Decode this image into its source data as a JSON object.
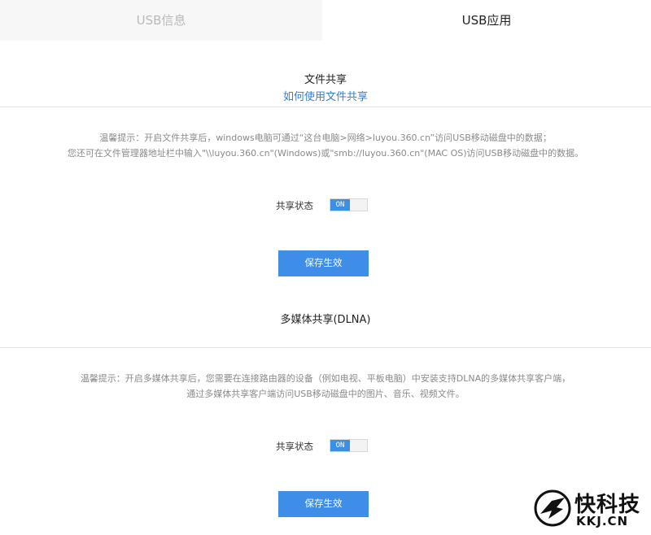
{
  "tabs": [
    {
      "label": "USB信息",
      "active": false
    },
    {
      "label": "USB应用",
      "active": true
    }
  ],
  "file_share": {
    "title": "文件共享",
    "help_link": "如何使用文件共享",
    "tip_line1": "温馨提示：开启文件共享后，windows电脑可通过“这台电脑>网络>luyou.360.cn”访问USB移动磁盘中的数据；",
    "tip_line2": "您还可在文件管理器地址栏中输入\"\\\\luyou.360.cn\"(Windows)或\"smb://luyou.360.cn\"(MAC OS)访问USB移动磁盘中的数据。",
    "status_label": "共享状态",
    "toggle_state": "ON",
    "save_label": "保存生效"
  },
  "dlna": {
    "title": "多媒体共享(DLNA)",
    "tip_line1": "温馨提示：开启多媒体共享后，您需要在连接路由器的设备（例如电视、平板电脑）中安装支持DLNA的多媒体共享客户端，",
    "tip_line2": "通过多媒体共享客户端访问USB移动磁盘中的图片、音乐、视频文件。",
    "status_label": "共享状态",
    "toggle_state": "ON",
    "save_label": "保存生效"
  },
  "watermark": {
    "text": "快科技",
    "domain": "KKJ.CN"
  },
  "colors": {
    "accent": "#3e8ee8",
    "link": "#2f7fd4",
    "inactive_tab_bg": "#f7f7f7"
  }
}
